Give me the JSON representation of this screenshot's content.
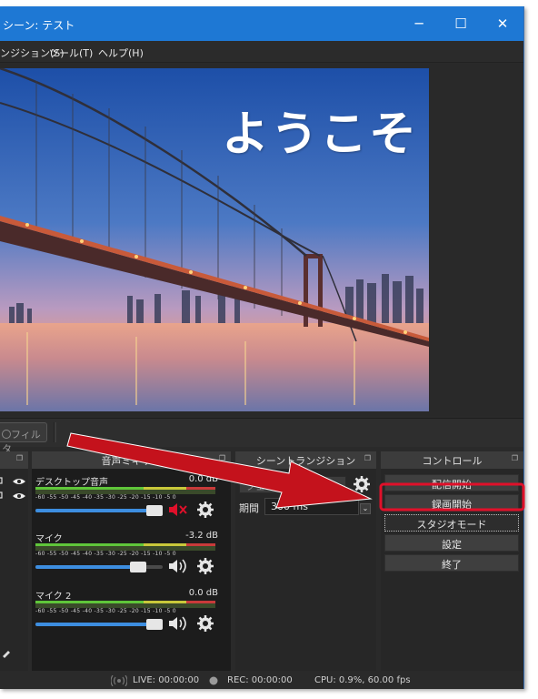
{
  "window": {
    "title": "シーン: テスト",
    "controls": {
      "minimize": "─",
      "maximize": "☐",
      "close": "✕"
    }
  },
  "menubar": {
    "items": [
      "ンジション(S)",
      "ツール(T)",
      "ヘルプ(H)"
    ]
  },
  "preview": {
    "overlay_text": "ようこそ"
  },
  "sources_toolbar": {
    "filter_label": "フィルタ"
  },
  "docks": {
    "mixer": {
      "title": "音声ミキサー"
    },
    "transitions": {
      "title": "シーントランジション",
      "transition_value": "フェード",
      "duration_label": "期間",
      "duration_value": "300 ms"
    },
    "controls": {
      "title": "コントロール"
    }
  },
  "mixer": {
    "scale": "-60 -55 -50 -45 -40 -35 -30 -25 -20 -15 -10 -5 0",
    "channels": [
      {
        "name": "デスクトップ音声",
        "db": "0.0 dB",
        "volume": 0.94,
        "muted": true
      },
      {
        "name": "マイク",
        "db": "-3.2 dB",
        "volume": 0.78,
        "muted": false
      },
      {
        "name": "マイク 2",
        "db": "0.0 dB",
        "volume": 0.94,
        "muted": false
      }
    ]
  },
  "controls": {
    "buttons": [
      "配信開始",
      "録画開始",
      "スタジオモード",
      "設定",
      "終了"
    ],
    "highlighted": "録画開始"
  },
  "statusbar": {
    "live": "LIVE: 00:00:00",
    "rec": "REC: 00:00:00",
    "cpu": "CPU: 0.9%, 60.00 fps"
  },
  "colors": {
    "titlebar": "#1e78d4",
    "highlight": "#e0102a",
    "arrow": "#c4121c",
    "meter_green": "#5fc63a",
    "meter_yellow": "#c8c83a",
    "meter_red": "#c83a3a",
    "slider_fill": "#3d8ee0"
  },
  "icons": [
    "eye-icon",
    "lock-icon",
    "gear-icon",
    "speaker-icon",
    "speaker-muted-icon",
    "chevron-down-icon",
    "live-icon",
    "rec-dot-icon",
    "filter-icon",
    "float-icon",
    "pen-icon"
  ]
}
